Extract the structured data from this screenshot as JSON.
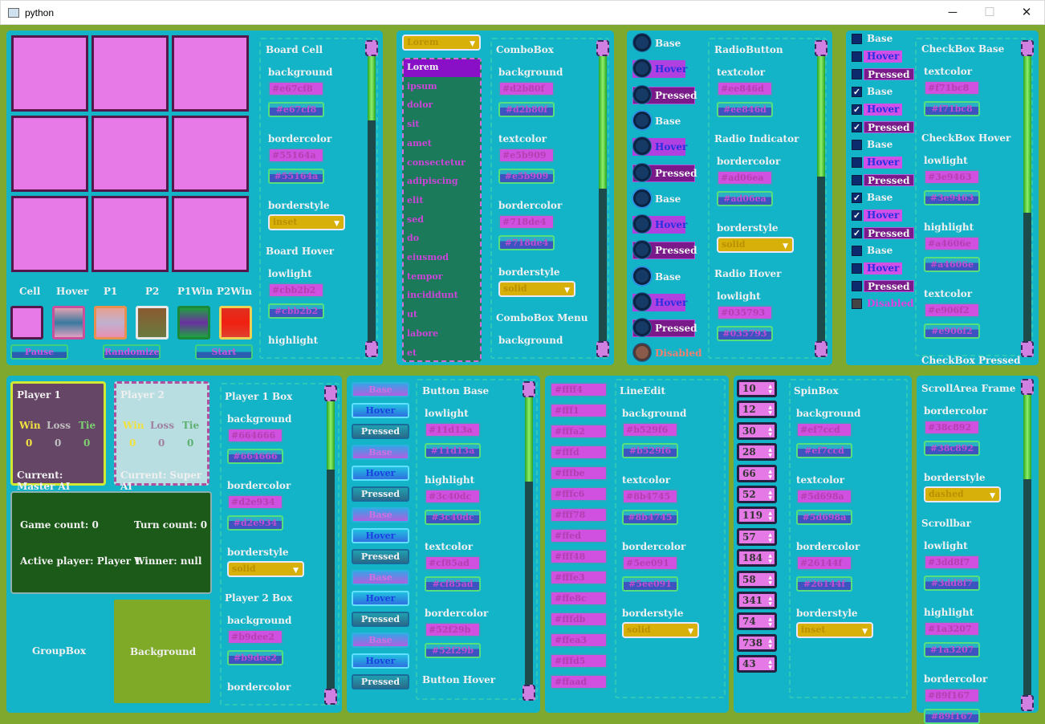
{
  "window": {
    "title": "python",
    "minimize": "─",
    "maximize": "☐",
    "close": "✕"
  },
  "board": {
    "legend": [
      "Cell",
      "Hover",
      "P1",
      "P2",
      "P1Win",
      "P2Win"
    ],
    "buttons": [
      "Pause",
      "Randomize",
      "Start"
    ]
  },
  "board_props": [
    {
      "type": "sec",
      "text": "Board Cell"
    },
    {
      "type": "fld",
      "label": "background",
      "value": "#e67cf8"
    },
    {
      "type": "fld",
      "label": "bordercolor",
      "value": "#55164a"
    },
    {
      "type": "cb",
      "label": "borderstyle",
      "value": "inset"
    },
    {
      "type": "sec",
      "text": "Board Hover"
    },
    {
      "type": "fld",
      "label": "lowlight",
      "value": "#cbb2b2"
    },
    {
      "type": "lbl",
      "label": "highlight"
    }
  ],
  "combo": {
    "current": "Lorem",
    "items": [
      "Lorem",
      "ipsum",
      "dolor",
      "sit",
      "amet",
      "consectetur",
      "adipiscing",
      "elit",
      "sed",
      "do",
      "eiusmod",
      "tempor",
      "incididunt",
      "ut",
      "labore",
      "et"
    ]
  },
  "combo_props": [
    {
      "type": "sec",
      "text": "ComboBox"
    },
    {
      "type": "fld",
      "label": "background",
      "value": "#d2b80f"
    },
    {
      "type": "fld",
      "label": "textcolor",
      "value": "#e5b909"
    },
    {
      "type": "fld",
      "label": "bordercolor",
      "value": "#718de4"
    },
    {
      "type": "cb",
      "label": "borderstyle",
      "value": "solid"
    },
    {
      "type": "sec",
      "text": "ComboBox Menu"
    },
    {
      "type": "lbl",
      "label": "background"
    }
  ],
  "radio": {
    "labels": [
      "Base",
      "Hover",
      "Pressed",
      "Base",
      "Hover",
      "Pressed",
      "Base",
      "Hover",
      "Pressed",
      "Base",
      "Hover",
      "Pressed"
    ],
    "disabled": "Disabled"
  },
  "radio_props": [
    {
      "type": "sec",
      "text": "RadioButton"
    },
    {
      "type": "fld",
      "label": "textcolor",
      "value": "#ee846d"
    },
    {
      "type": "sec",
      "text": "Radio Indicator"
    },
    {
      "type": "fld",
      "label": "bordercolor",
      "value": "#ad06ea"
    },
    {
      "type": "cb",
      "label": "borderstyle",
      "value": "solid"
    },
    {
      "type": "sec",
      "text": "Radio Hover"
    },
    {
      "type": "fld",
      "label": "lowlight",
      "value": "#035793"
    }
  ],
  "check": {
    "labels": [
      "Base",
      "Hover",
      "Pressed",
      "Base",
      "Hover",
      "Pressed",
      "Base",
      "Hover",
      "Pressed",
      "Base",
      "Hover",
      "Pressed",
      "Base",
      "Hover",
      "Pressed"
    ],
    "disabled": "Disabled"
  },
  "check_props": [
    {
      "type": "sec",
      "text": "CheckBox Base"
    },
    {
      "type": "fld",
      "label": "textcolor",
      "value": "#f71bc8"
    },
    {
      "type": "sec",
      "text": "CheckBox Hover"
    },
    {
      "type": "fld",
      "label": "lowlight",
      "value": "#3e9463"
    },
    {
      "type": "fld",
      "label": "highlight",
      "value": "#a4606e"
    },
    {
      "type": "fld",
      "label": "textcolor",
      "value": "#e906f2"
    },
    {
      "type": "sec",
      "text": "CheckBox Pressed"
    }
  ],
  "player1": {
    "title": "Player 1",
    "win": "Win",
    "loss": "Loss",
    "tie": "Tie",
    "w": "0",
    "l": "0",
    "t": "0",
    "current": "Current: Master AI"
  },
  "player2": {
    "title": "Player 2",
    "win": "Win",
    "loss": "Loss",
    "tie": "Tie",
    "w": "0",
    "l": "0",
    "t": "0",
    "current": "Current: Super AI"
  },
  "game": {
    "game_count": "Game count: 0",
    "turn_count": "Turn count: 0",
    "active": "Active player: Player 1",
    "winner": "Winner: null"
  },
  "groupbox": "GroupBox",
  "background_label": "Background",
  "player_props": [
    {
      "type": "sec",
      "text": "Player 1 Box"
    },
    {
      "type": "fld",
      "label": "background",
      "value": "#664666"
    },
    {
      "type": "fld",
      "label": "bordercolor",
      "value": "#d2e934"
    },
    {
      "type": "cb",
      "label": "borderstyle",
      "value": "solid"
    },
    {
      "type": "sec",
      "text": "Player 2 Box"
    },
    {
      "type": "fld",
      "label": "background",
      "value": "#b9dee2"
    },
    {
      "type": "lbl",
      "label": "bordercolor"
    }
  ],
  "buttons": {
    "labels": [
      "Base",
      "Hover",
      "Pressed",
      "Base",
      "Hover",
      "Pressed",
      "Base",
      "Hover",
      "Pressed",
      "Base",
      "Hover",
      "Pressed",
      "Base",
      "Hover",
      "Pressed"
    ]
  },
  "button_props": [
    {
      "type": "sec",
      "text": "Button Base"
    },
    {
      "type": "fld",
      "label": "lowlight",
      "value": "#11d13a"
    },
    {
      "type": "fld",
      "label": "highlight",
      "value": "#3c40dc"
    },
    {
      "type": "fld",
      "label": "textcolor",
      "value": "#cf85ad"
    },
    {
      "type": "fld",
      "label": "bordercolor",
      "value": "#52f29b"
    },
    {
      "type": "sec",
      "text": "Button Hover"
    }
  ],
  "lineedits": [
    "#ffff4",
    "#fff1",
    "#fffa2",
    "#fffd",
    "#fffbe",
    "#fffc6",
    "#fff78",
    "#ffed",
    "#fff48",
    "#fffe3",
    "#ffe8c",
    "#fffdb",
    "#ffea3",
    "#fffd5",
    "#ffaad"
  ],
  "lineedit_props": [
    {
      "type": "sec",
      "text": "LineEdit"
    },
    {
      "type": "fld",
      "label": "background",
      "value": "#b529f6"
    },
    {
      "type": "fld",
      "label": "textcolor",
      "value": "#8b4745"
    },
    {
      "type": "fld",
      "label": "bordercolor",
      "value": "#5ee091"
    },
    {
      "type": "cb",
      "label": "borderstyle",
      "value": "solid"
    }
  ],
  "spins": [
    "10",
    "12",
    "30",
    "28",
    "66",
    "52",
    "119",
    "57",
    "184",
    "58",
    "341",
    "74",
    "738",
    "43"
  ],
  "spin_props": [
    {
      "type": "sec",
      "text": "SpinBox"
    },
    {
      "type": "fld",
      "label": "background",
      "value": "#ef7ccd"
    },
    {
      "type": "fld",
      "label": "textcolor",
      "value": "#5d698a"
    },
    {
      "type": "fld",
      "label": "bordercolor",
      "value": "#26144f"
    },
    {
      "type": "cb",
      "label": "borderstyle",
      "value": "inset"
    }
  ],
  "scroll_props": [
    {
      "type": "sec",
      "text": "ScrollArea Frame"
    },
    {
      "type": "fld",
      "label": "bordercolor",
      "value": "#38c892"
    },
    {
      "type": "cb",
      "label": "borderstyle",
      "value": "dashed"
    },
    {
      "type": "sec",
      "text": "Scrollbar"
    },
    {
      "type": "fld",
      "label": "lowlight",
      "value": "#3dd8f7"
    },
    {
      "type": "fld",
      "label": "highlight",
      "value": "#1a3207"
    },
    {
      "type": "fld",
      "label": "bordercolor",
      "value": "#89f167"
    }
  ],
  "colors": {
    "panel": "#14b4c8",
    "cell": "#e87ae8",
    "cell_border": "#55164a",
    "page": "#7fa82e"
  }
}
